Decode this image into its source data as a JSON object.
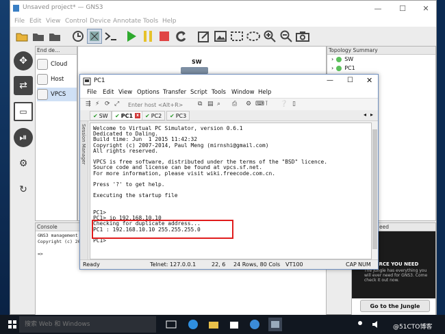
{
  "gns3": {
    "window_title": "Unsaved project* — GNS3",
    "menu": [
      "File",
      "Edit",
      "View",
      "Control",
      "Device",
      "Annotate",
      "Tools",
      "Help"
    ],
    "end_devices_title": "End de…",
    "end_devices": [
      "Cloud",
      "Host",
      "VPCS"
    ],
    "topology_title": "Topology Summary",
    "topology_items": [
      "SW",
      "PC1"
    ],
    "canvas_node_label": "SW",
    "console_title": "Console",
    "console_text": "GNS3 management c\nCopyright (c) 200\n\n=>",
    "newsfeed_title": "eed",
    "news_heading": "ESOURCE YOU NEED",
    "news_body": "The Jungle has everything you will ever need for GNS3. Come check it out now.",
    "news_button": "Go to the Jungle"
  },
  "pc1": {
    "title": "PC1",
    "menu": [
      "File",
      "Edit",
      "View",
      "Options",
      "Transfer",
      "Script",
      "Tools",
      "Window",
      "Help"
    ],
    "host_placeholder": "Enter host <Alt+R>",
    "tabs": [
      "SW",
      "PC1",
      "PC2",
      "PC3"
    ],
    "session_manager": "Session Manager",
    "terminal_text": "Welcome to Virtual PC Simulator, version 0.6.1\nDedicated to Daling.\nBuild time: Jun  1 2015 11:42:32\nCopyright (c) 2007-2014, Paul Meng (mirnshi@gmail.com)\nAll rights reserved.\n\nVPCS is free software, distributed under the terms of the \"BSD\" licence.\nSource code and license can be found at vpcs.sf.net.\nFor more information, please visit wiki.freecode.com.cn.\n\nPress '?' to get help.\n\nExecuting the startup file\n\n\nPC1>\nPC1> ip 192.168.10.10\nChecking for duplicate address...\nPC1 : 192.168.10.10 255.255.255.0\n\nPC1>",
    "status": {
      "ready": "Ready",
      "telnet": "Telnet: 127.0.0.1",
      "cursor": "22,  6",
      "size": "24 Rows, 80 Cols",
      "emulation": "VT100",
      "cap": "CAP",
      "num": "NUM"
    }
  },
  "taskbar": {
    "search_placeholder": "搜索 Web 和 Windows",
    "watermark": "@51CTO博客"
  }
}
